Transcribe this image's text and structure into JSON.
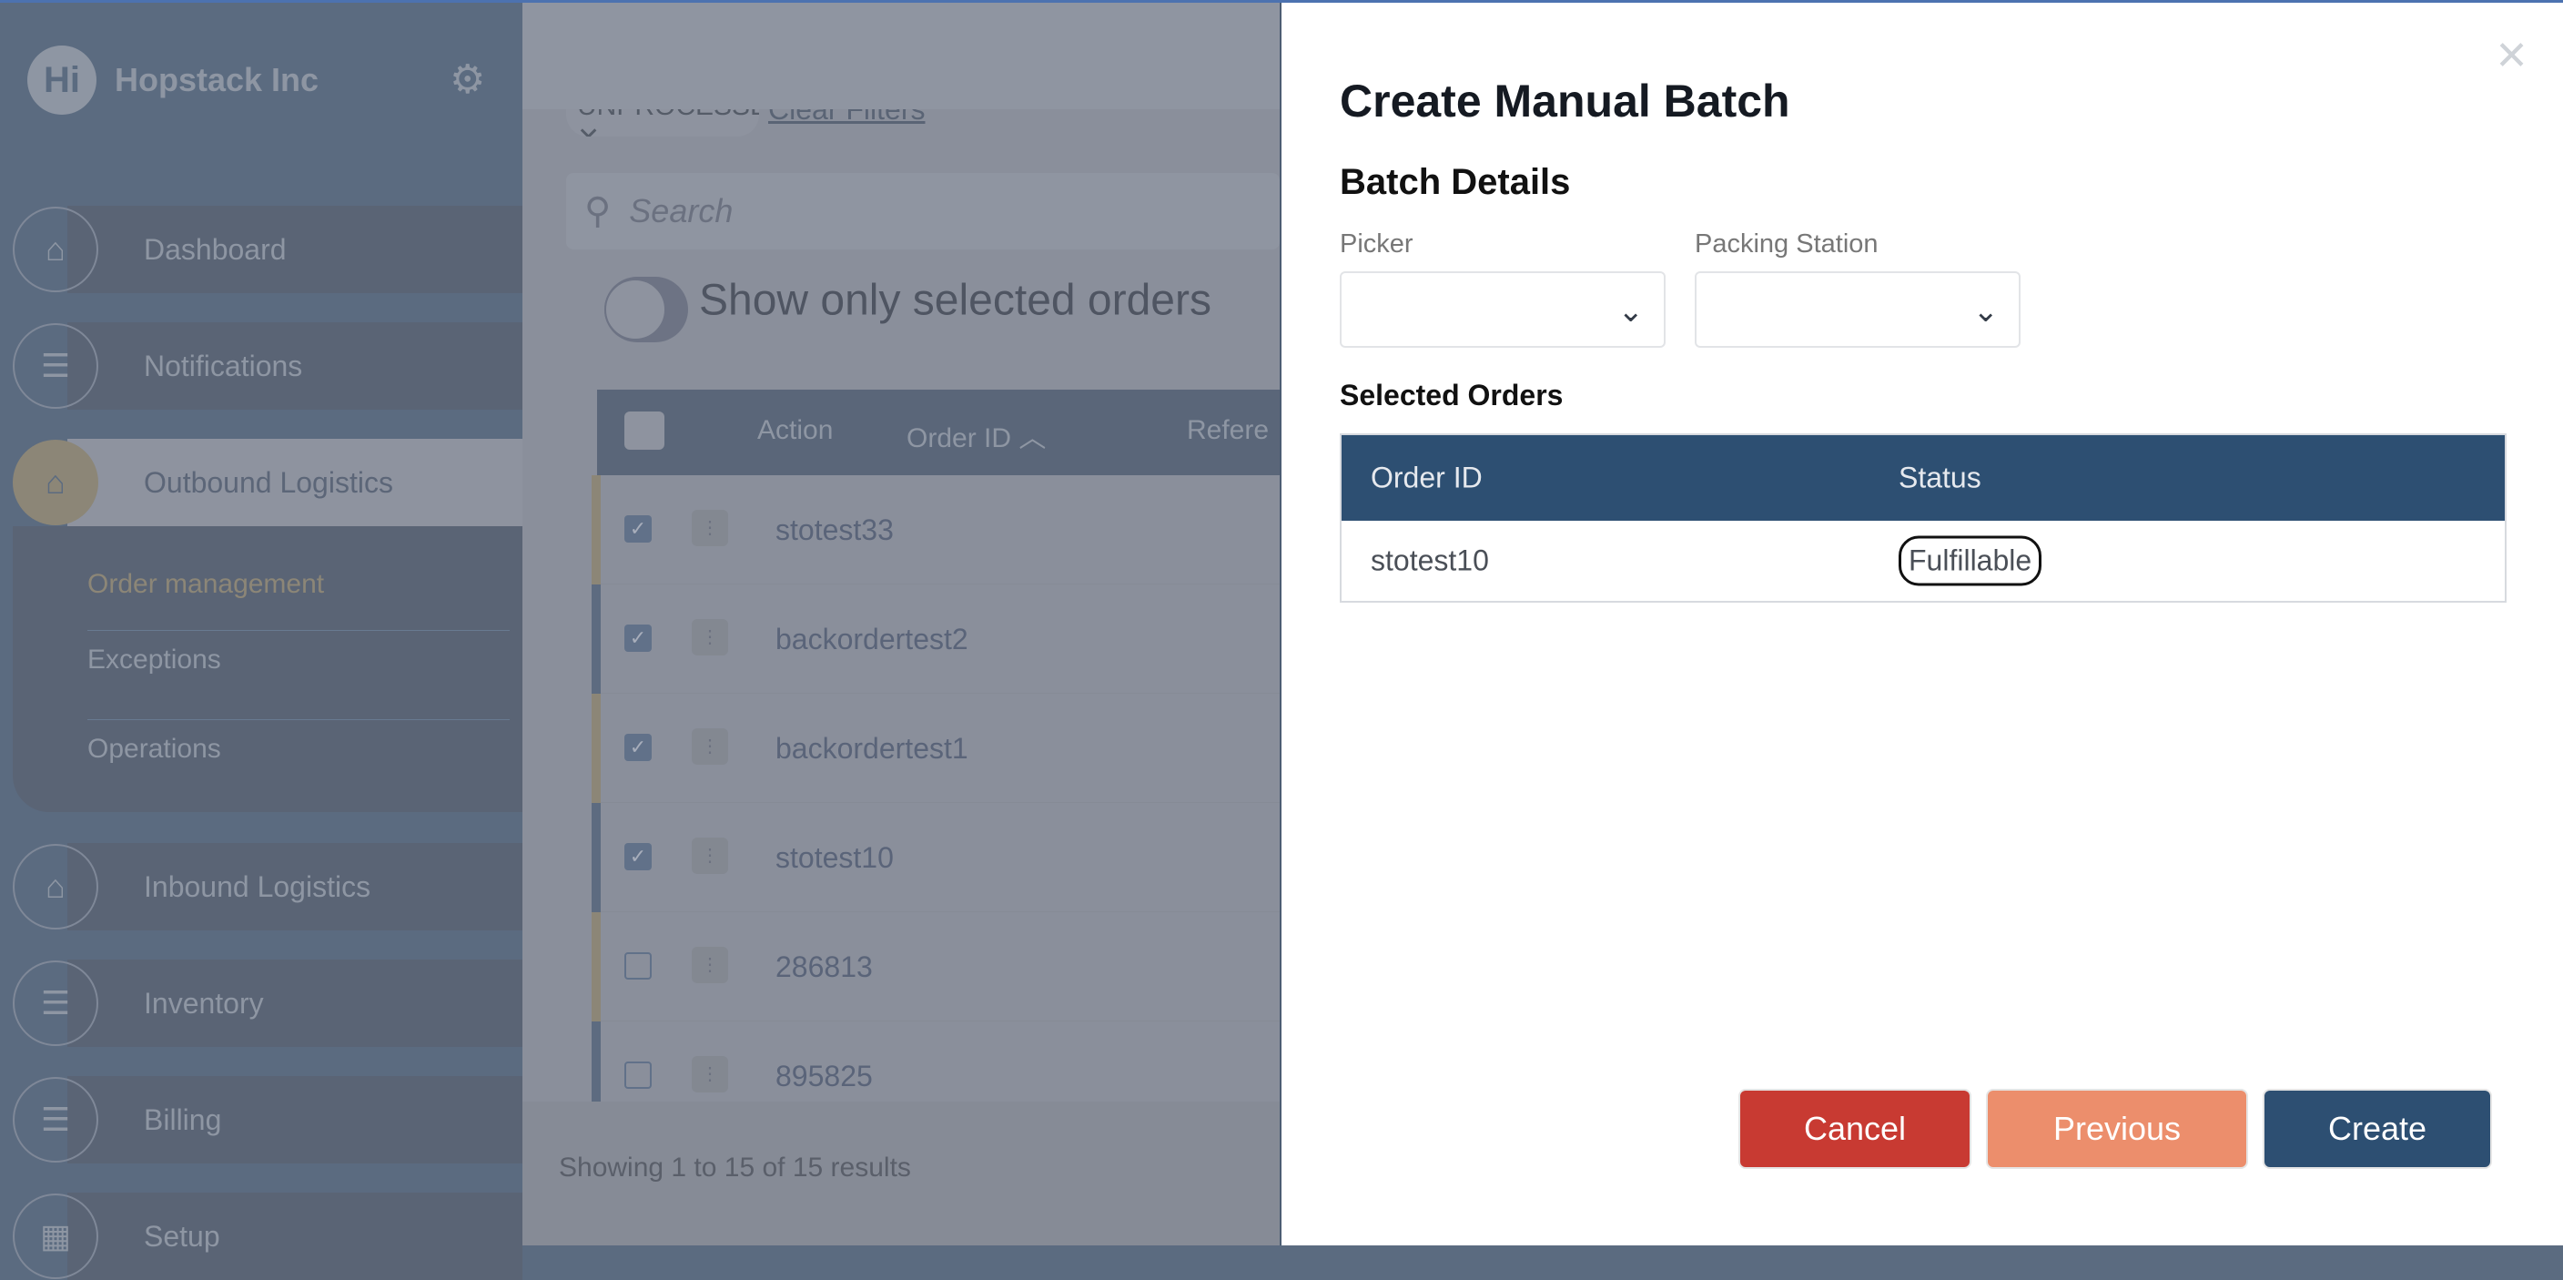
{
  "app": {
    "brand": "Hopstack Inc",
    "logo_letter": "Hi"
  },
  "colors": {
    "primary": "#2d4f72",
    "cancel": "#c83a32",
    "previous": "#ec8e6c",
    "accent_active": "#8c8677"
  },
  "sidebar": {
    "items": [
      {
        "label": "Dashboard",
        "icon": "warehouse-icon"
      },
      {
        "label": "Notifications",
        "icon": "checklist-icon"
      },
      {
        "label": "Outbound Logistics",
        "icon": "warehouse-icon",
        "active": true
      },
      {
        "label": "Inbound Logistics",
        "icon": "warehouse-icon"
      },
      {
        "label": "Inventory",
        "icon": "checklist-icon"
      },
      {
        "label": "Billing",
        "icon": "checklist-icon"
      },
      {
        "label": "Setup",
        "icon": "conveyor-icon"
      }
    ],
    "subitems": [
      {
        "label": "Order management",
        "active": true
      },
      {
        "label": "Exceptions"
      },
      {
        "label": "Operations"
      }
    ]
  },
  "main": {
    "filter_chip": "UNPROCESSED",
    "clear_filters": "Clear Filters",
    "search_placeholder": "Search",
    "toggle_label": "Show only selected orders",
    "columns": [
      "Action",
      "Order ID",
      "Refere"
    ],
    "rows": [
      {
        "order_id": "stotest33",
        "checked": true
      },
      {
        "order_id": "backordertest2",
        "checked": true
      },
      {
        "order_id": "backordertest1",
        "checked": true
      },
      {
        "order_id": "stotest10",
        "checked": true
      },
      {
        "order_id": "286813",
        "checked": false
      },
      {
        "order_id": "895825",
        "checked": false
      }
    ],
    "footer": "Showing 1 to 15 of 15 results"
  },
  "modal": {
    "title": "Create Manual Batch",
    "section": "Batch Details",
    "picker_label": "Picker",
    "picker_value": "",
    "packing_label": "Packing Station",
    "packing_value": "",
    "selected_title": "Selected Orders",
    "columns": [
      "Order ID",
      "Status"
    ],
    "rows": [
      {
        "order_id": "stotest10",
        "status": "Fulfillable"
      }
    ],
    "buttons": {
      "cancel": "Cancel",
      "previous": "Previous",
      "create": "Create"
    }
  }
}
